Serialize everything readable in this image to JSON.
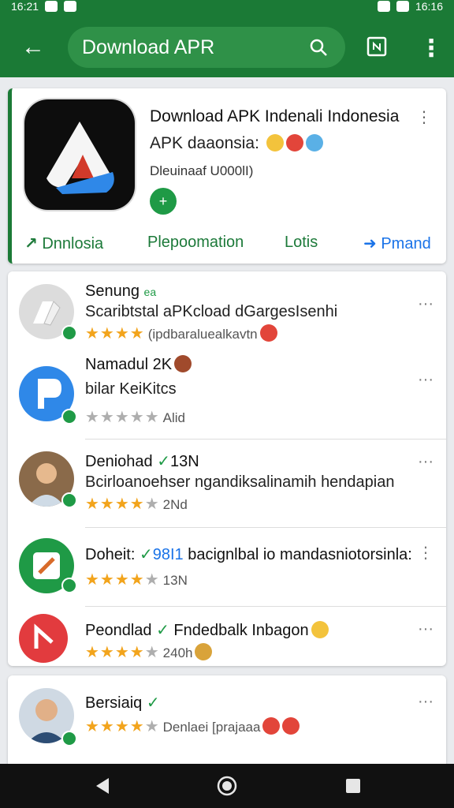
{
  "status": {
    "time_left": "16:21",
    "time_right": "16:16"
  },
  "search": {
    "text": "Download APR"
  },
  "featured": {
    "title": "Download APK Indenali Indonesia",
    "subtitle": "APK daaonsia:",
    "meta": "Dleuinaaf U000lI)",
    "tabs": [
      {
        "label": "Dnnlosia"
      },
      {
        "label": "Plepoomation"
      },
      {
        "label": "Lotis"
      },
      {
        "label": "Pmand"
      }
    ]
  },
  "list": [
    {
      "title": "Senung",
      "tag": "ea",
      "line": "Scaribtstal aPKcload dGargesIsenhi",
      "stars_on": 4,
      "meta": "(ipdbaraluealkavtn"
    },
    {
      "title": "Namadul 2K",
      "line": "bilar KeiKitcs",
      "stars_on": 0,
      "meta": "Alid"
    },
    {
      "title": "Deniohad",
      "badge_text": "13N",
      "line": "Bcirloanoehser ngandiksalinamih hendapian",
      "stars_on": 4,
      "meta": "2Nd"
    },
    {
      "title": "Doheit:",
      "badge_text": "98I1",
      "line": "bacignlbal io mandasniotorsinla:",
      "stars_on": 4,
      "meta": "13N"
    },
    {
      "title": "Peondlad",
      "line": "Fndedbalk Inbagon",
      "stars_on": 4,
      "meta": "240h"
    }
  ],
  "list2": [
    {
      "title": "Bersiaiq",
      "stars_on": 4,
      "meta": "Denlaei [prajaaa"
    }
  ],
  "icons": [
    "back-arrow-icon",
    "search-icon",
    "open-in-icon",
    "kebab-icon",
    "more-icon",
    "star-icon",
    "verified-icon"
  ],
  "colors": {
    "primary": "#1b7a36",
    "search_bg": "#2f9148",
    "star": "#f2a41c",
    "link": "#1a73e8"
  }
}
